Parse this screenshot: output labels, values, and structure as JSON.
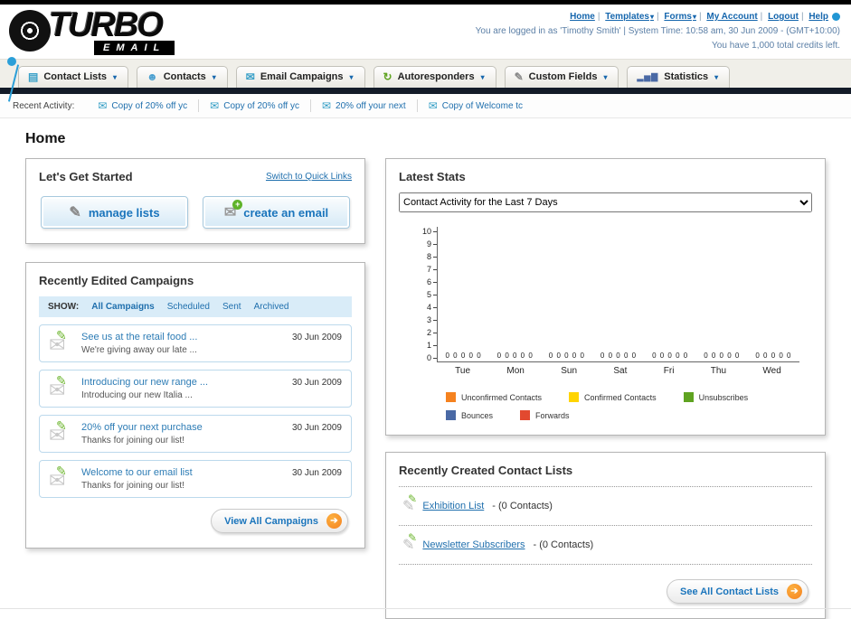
{
  "header": {
    "links": [
      "Home",
      "Templates",
      "Forms",
      "My Account",
      "Logout",
      "Help"
    ],
    "separator": "|",
    "login_info": "You are logged in as 'Timothy Smith' | System Time: 10:58 am, 30 Jun 2009 - (GMT+10:00)",
    "credits": "You have 1,000 total credits left.",
    "logo_line1": "TURBO",
    "logo_line2": "EMAIL"
  },
  "nav": {
    "items": [
      "Contact Lists",
      "Contacts",
      "Email Campaigns",
      "Autoresponders",
      "Custom Fields",
      "Statistics"
    ]
  },
  "recent_activity": {
    "label": "Recent Activity:",
    "items": [
      "Copy of 20% off yc",
      "Copy of 20% off yc",
      "20% off your next",
      "Copy of Welcome tc"
    ]
  },
  "page": {
    "title": "Home"
  },
  "get_started": {
    "title": "Let's Get Started",
    "switch_link": "Switch to Quick Links",
    "manage_button": "manage lists",
    "create_button": "create an email"
  },
  "campaigns": {
    "title": "Recently Edited Campaigns",
    "show_label": "SHOW:",
    "tabs": [
      "All Campaigns",
      "Scheduled",
      "Sent",
      "Archived"
    ],
    "active_tab": "All Campaigns",
    "rows": [
      {
        "title": "See us at the retail food ...",
        "subtitle": "We're giving away our late ...",
        "date": "30 Jun 2009"
      },
      {
        "title": "Introducing our new range ...",
        "subtitle": "Introducing our new Italia ...",
        "date": "30 Jun 2009"
      },
      {
        "title": "20% off your next purchase",
        "subtitle": "Thanks for joining our list!",
        "date": "30 Jun 2009"
      },
      {
        "title": "Welcome to our email list",
        "subtitle": "Thanks for joining our list!",
        "date": "30 Jun 2009"
      }
    ],
    "view_all": "View All Campaigns"
  },
  "stats": {
    "title": "Latest Stats",
    "dropdown_value": "Contact Activity for the Last 7 Days"
  },
  "chart_data": {
    "type": "bar",
    "title": "Contact Activity for the Last 7 Days",
    "categories": [
      "Tue",
      "Mon",
      "Sun",
      "Sat",
      "Fri",
      "Thu",
      "Wed"
    ],
    "series": [
      {
        "name": "Unconfirmed Contacts",
        "values": [
          0,
          0,
          0,
          0,
          0,
          0,
          0
        ]
      },
      {
        "name": "Confirmed Contacts",
        "values": [
          0,
          0,
          0,
          0,
          0,
          0,
          0
        ]
      },
      {
        "name": "Unsubscribes",
        "values": [
          0,
          0,
          0,
          0,
          0,
          0,
          0
        ]
      },
      {
        "name": "Bounces",
        "values": [
          0,
          0,
          0,
          0,
          0,
          0,
          0
        ]
      },
      {
        "name": "Forwards",
        "values": [
          0,
          0,
          0,
          0,
          0,
          0,
          0
        ]
      }
    ],
    "ylim": [
      0,
      10
    ],
    "yticks": [
      0,
      1,
      2,
      3,
      4,
      5,
      6,
      7,
      8,
      9,
      10
    ],
    "value_label_row": "0 0 0 0 0",
    "grid": false,
    "legend_position": "bottom",
    "legend": [
      {
        "label": "Unconfirmed Contacts",
        "color": "#F5821F"
      },
      {
        "label": "Confirmed Contacts",
        "color": "#FFD400"
      },
      {
        "label": "Unsubscribes",
        "color": "#5FA321"
      },
      {
        "label": "Bounces",
        "color": "#4A69A5"
      },
      {
        "label": "Forwards",
        "color": "#E2492F"
      }
    ]
  },
  "contact_lists": {
    "title": "Recently Created Contact Lists",
    "items": [
      {
        "name": "Exhibition List",
        "count": "- (0 Contacts)"
      },
      {
        "name": "Newsletter Subscribers",
        "count": "- (0 Contacts)"
      }
    ],
    "see_all": "See All Contact Lists"
  }
}
